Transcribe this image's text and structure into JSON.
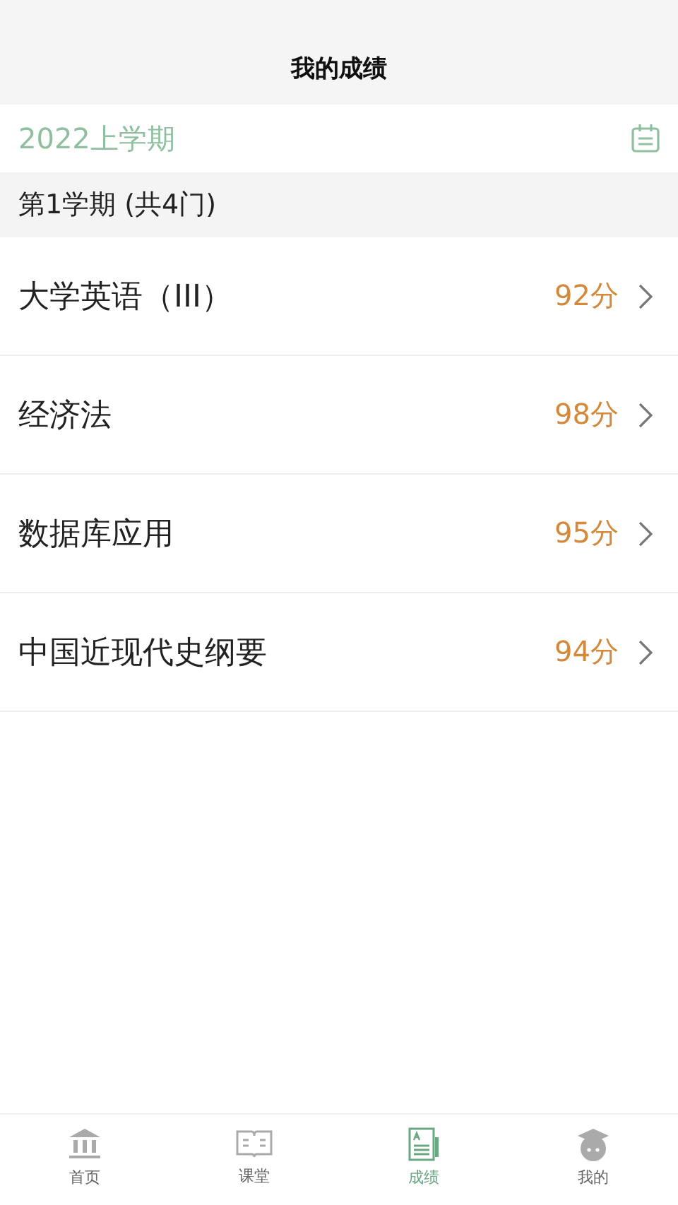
{
  "header": {
    "title": "我的成绩"
  },
  "term": {
    "label": "2022上学期"
  },
  "semester": {
    "label": "第1学期 (共4门)"
  },
  "courses": [
    {
      "name": "大学英语（III）",
      "score": "92分"
    },
    {
      "name": "经济法",
      "score": "98分"
    },
    {
      "name": "数据库应用",
      "score": "95分"
    },
    {
      "name": "中国近现代史纲要",
      "score": "94分"
    }
  ],
  "tabs": [
    {
      "kind": "home",
      "label": "首页",
      "selected": false
    },
    {
      "kind": "class",
      "label": "课堂",
      "selected": false
    },
    {
      "kind": "grades",
      "label": "成绩",
      "selected": true
    },
    {
      "kind": "me",
      "label": "我的",
      "selected": false
    }
  ]
}
